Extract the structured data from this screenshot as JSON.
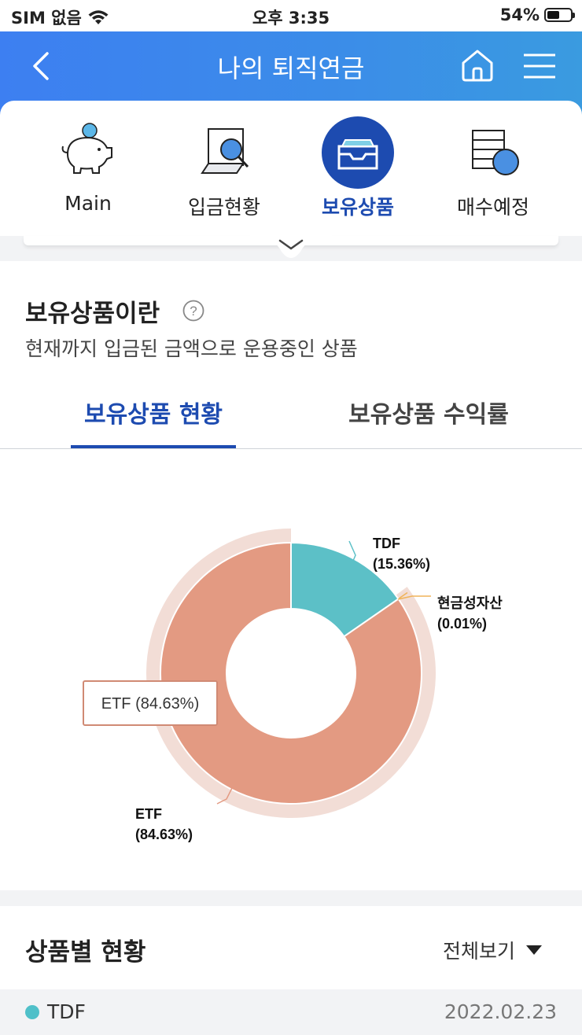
{
  "status_bar": {
    "carrier": "SIM 없음",
    "time": "오후 3:35",
    "battery": "54%",
    "battery_level": 0.54
  },
  "header": {
    "title": "나의 퇴직연금"
  },
  "nav": {
    "items": [
      {
        "label": "Main",
        "icon": "piggy-bank-icon"
      },
      {
        "label": "입금현황",
        "icon": "magnifier-document-icon"
      },
      {
        "label": "보유상품",
        "icon": "inbox-tray-icon",
        "active": true
      },
      {
        "label": "매수예정",
        "icon": "stack-clock-icon"
      }
    ]
  },
  "info": {
    "title": "보유상품이란",
    "description": "현재까지 입금된 금액으로 운용중인 상품"
  },
  "tabs": [
    {
      "label": "보유상품 현황",
      "active": true
    },
    {
      "label": "보유상품 수익률"
    }
  ],
  "chart_data": {
    "type": "pie",
    "slices": [
      {
        "name": "TDF",
        "value": 15.36,
        "label": "(15.36%)",
        "color": "#5cc0c7"
      },
      {
        "name": "현금성자산",
        "value": 0.01,
        "label": "(0.01%)",
        "color": "#f0b45a"
      },
      {
        "name": "ETF",
        "value": 84.63,
        "label": "(84.63%)",
        "color": "#e39a82"
      }
    ],
    "tooltip": "ETF (84.63%)"
  },
  "products": {
    "title": "상품별 현황",
    "filter": "전체보기",
    "rows": [
      {
        "name": "TDF",
        "date": "2022.02.23",
        "color": "#4fc0c9"
      }
    ]
  },
  "colors": {
    "primary": "#1d4bb0",
    "header_start": "#3d7ff1",
    "header_end": "#3a9be0"
  }
}
